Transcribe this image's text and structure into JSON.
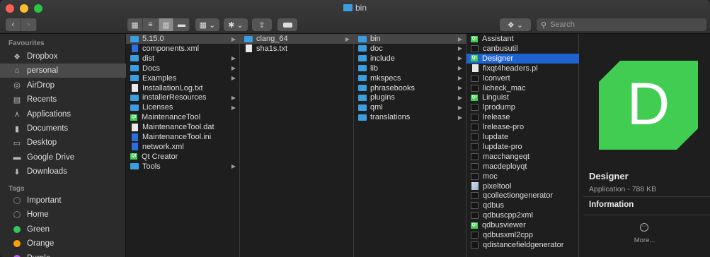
{
  "window": {
    "title": "bin"
  },
  "toolbar": {
    "search_placeholder": "Search",
    "dropbox_glyph": "❖",
    "share_glyph": "⇪",
    "action_glyph": "✱"
  },
  "sidebar": {
    "favourites_heading": "Favourites",
    "items": [
      {
        "label": "Dropbox",
        "icon": "dropbox-icon",
        "glyph": "❖"
      },
      {
        "label": "personal",
        "icon": "home-icon",
        "glyph": "⌂"
      },
      {
        "label": "AirDrop",
        "icon": "airdrop-icon",
        "glyph": "◎"
      },
      {
        "label": "Recents",
        "icon": "recents-icon",
        "glyph": "▤"
      },
      {
        "label": "Applications",
        "icon": "applications-icon",
        "glyph": "⋏"
      },
      {
        "label": "Documents",
        "icon": "documents-icon",
        "glyph": "▮"
      },
      {
        "label": "Desktop",
        "icon": "desktop-icon",
        "glyph": "▭"
      },
      {
        "label": "Google Drive",
        "icon": "folder-icon",
        "glyph": "▬"
      },
      {
        "label": "Downloads",
        "icon": "downloads-icon",
        "glyph": "⬇"
      }
    ],
    "tags_heading": "Tags",
    "tags": [
      {
        "label": "Important",
        "color": "#2b2b2b",
        "border": "#777"
      },
      {
        "label": "Home",
        "color": "#2b2b2b",
        "border": "#777"
      },
      {
        "label": "Green",
        "color": "#34c759",
        "border": "#34c759"
      },
      {
        "label": "Orange",
        "color": "#ff9f0a",
        "border": "#ff9f0a"
      },
      {
        "label": "Purple",
        "color": "#bf5af2",
        "border": "#bf5af2"
      }
    ]
  },
  "columns": [
    {
      "items": [
        {
          "name": "5.15.0",
          "type": "folder",
          "arrow": true,
          "state": "grey"
        },
        {
          "name": "components.xml",
          "type": "xml"
        },
        {
          "name": "dist",
          "type": "folder",
          "arrow": true
        },
        {
          "name": "Docs",
          "type": "folder",
          "arrow": true
        },
        {
          "name": "Examples",
          "type": "folder",
          "arrow": true
        },
        {
          "name": "InstallationLog.txt",
          "type": "doc"
        },
        {
          "name": "installerResources",
          "type": "folder",
          "arrow": true
        },
        {
          "name": "Licenses",
          "type": "folder",
          "arrow": true
        },
        {
          "name": "MaintenanceTool",
          "type": "qt"
        },
        {
          "name": "MaintenanceTool.dat",
          "type": "doc"
        },
        {
          "name": "MaintenanceTool.ini",
          "type": "xml"
        },
        {
          "name": "network.xml",
          "type": "xml"
        },
        {
          "name": "Qt Creator",
          "type": "qt"
        },
        {
          "name": "Tools",
          "type": "folder",
          "arrow": true
        }
      ]
    },
    {
      "items": [
        {
          "name": "clang_64",
          "type": "folder",
          "arrow": true,
          "state": "grey"
        },
        {
          "name": "sha1s.txt",
          "type": "doc"
        }
      ]
    },
    {
      "items": [
        {
          "name": "bin",
          "type": "folder",
          "arrow": true,
          "state": "grey"
        },
        {
          "name": "doc",
          "type": "folder",
          "arrow": true
        },
        {
          "name": "include",
          "type": "folder",
          "arrow": true
        },
        {
          "name": "lib",
          "type": "folder",
          "arrow": true
        },
        {
          "name": "mkspecs",
          "type": "folder",
          "arrow": true
        },
        {
          "name": "phrasebooks",
          "type": "folder",
          "arrow": true
        },
        {
          "name": "plugins",
          "type": "folder",
          "arrow": true
        },
        {
          "name": "qml",
          "type": "folder",
          "arrow": true
        },
        {
          "name": "translations",
          "type": "folder",
          "arrow": true
        }
      ]
    },
    {
      "items": [
        {
          "name": "Assistant",
          "type": "qt"
        },
        {
          "name": "canbusutil",
          "type": "exec"
        },
        {
          "name": "Designer",
          "type": "qt",
          "state": "blue"
        },
        {
          "name": "fixqt4headers.pl",
          "type": "doc"
        },
        {
          "name": "lconvert",
          "type": "exec"
        },
        {
          "name": "licheck_mac",
          "type": "exec"
        },
        {
          "name": "Linguist",
          "type": "qt"
        },
        {
          "name": "lprodump",
          "type": "exec"
        },
        {
          "name": "lrelease",
          "type": "exec"
        },
        {
          "name": "lrelease-pro",
          "type": "exec"
        },
        {
          "name": "lupdate",
          "type": "exec"
        },
        {
          "name": "lupdate-pro",
          "type": "exec"
        },
        {
          "name": "macchangeqt",
          "type": "exec"
        },
        {
          "name": "macdeployqt",
          "type": "exec"
        },
        {
          "name": "moc",
          "type": "exec"
        },
        {
          "name": "pixeltool",
          "type": "img"
        },
        {
          "name": "qcollectiongenerator",
          "type": "exec"
        },
        {
          "name": "qdbus",
          "type": "exec"
        },
        {
          "name": "qdbuscpp2xml",
          "type": "exec"
        },
        {
          "name": "qdbusviewer",
          "type": "qt"
        },
        {
          "name": "qdbusxml2cpp",
          "type": "exec"
        },
        {
          "name": "qdistancefieldgenerator",
          "type": "exec"
        }
      ]
    }
  ],
  "preview": {
    "icon_letter": "D",
    "name": "Designer",
    "kind": "Application - 788 KB",
    "info_heading": "Information",
    "more_label": "More...",
    "icon_color": "#41cd52"
  }
}
